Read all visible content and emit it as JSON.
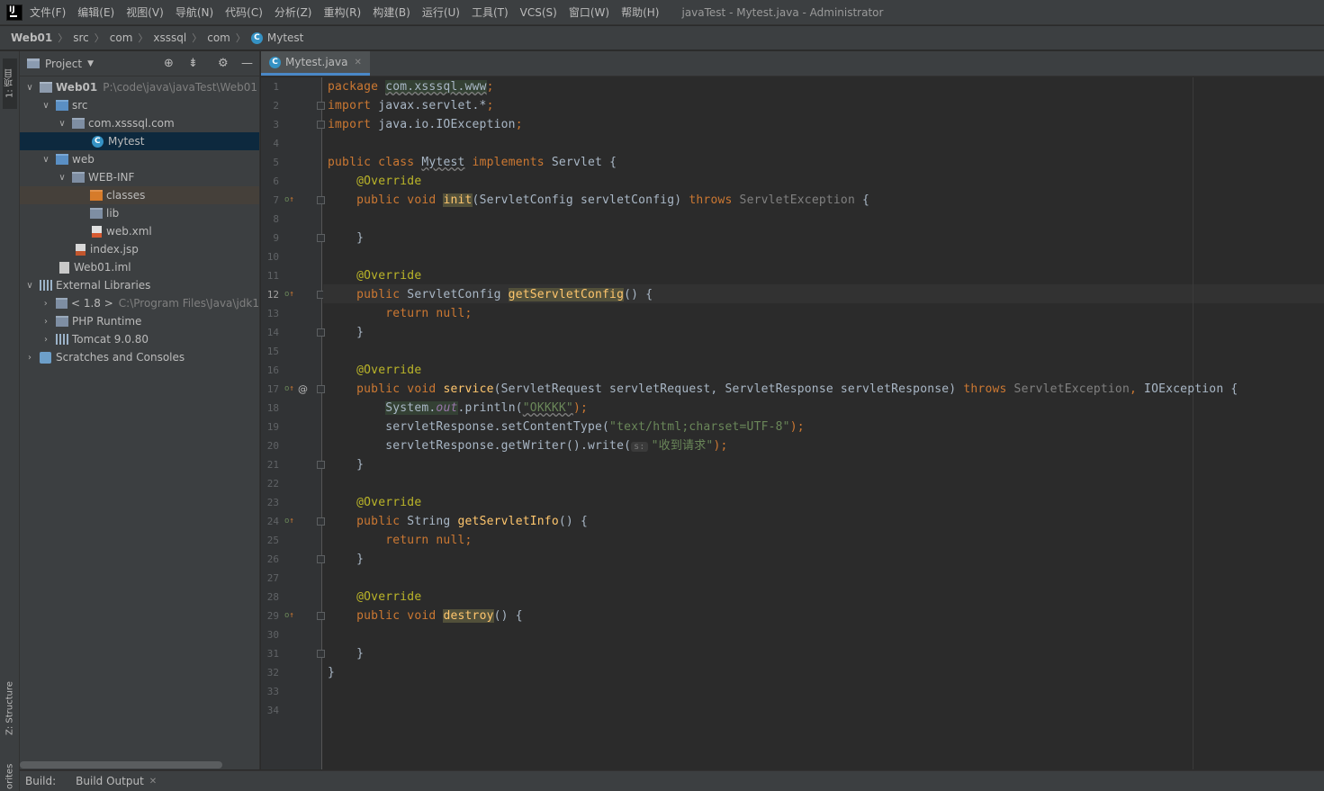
{
  "menubar": {
    "items": [
      "文件(F)",
      "编辑(E)",
      "视图(V)",
      "导航(N)",
      "代码(C)",
      "分析(Z)",
      "重构(R)",
      "构建(B)",
      "运行(U)",
      "工具(T)",
      "VCS(S)",
      "窗口(W)",
      "帮助(H)"
    ],
    "window_title": "javaTest - Mytest.java - Administrator"
  },
  "breadcrumb": [
    "Web01",
    "src",
    "com",
    "xsssql",
    "com",
    "Mytest"
  ],
  "left_strip": {
    "project_tab": "1: 项目",
    "structure_tab": "Z: Structure",
    "favorites_tab": "orites"
  },
  "project_panel": {
    "title": "Project",
    "tree": [
      {
        "label": "Web01",
        "extra": "P:\\code\\java\\javaTest\\Web01"
      },
      {
        "label": "src"
      },
      {
        "label": "com.xsssql.com"
      },
      {
        "label": "Mytest"
      },
      {
        "label": "web"
      },
      {
        "label": "WEB-INF"
      },
      {
        "label": "classes"
      },
      {
        "label": "lib"
      },
      {
        "label": "web.xml"
      },
      {
        "label": "index.jsp"
      },
      {
        "label": "Web01.iml"
      },
      {
        "label": "External Libraries"
      },
      {
        "label": "< 1.8 >",
        "extra": "C:\\Program Files\\Java\\jdk1"
      },
      {
        "label": "PHP Runtime"
      },
      {
        "label": "Tomcat 9.0.80"
      },
      {
        "label": "Scratches and Consoles"
      }
    ]
  },
  "editor": {
    "tab_label": "Mytest.java",
    "line_numbers": [
      "1",
      "2",
      "3",
      "4",
      "5",
      "6",
      "7",
      "8",
      "9",
      "10",
      "11",
      "12",
      "13",
      "14",
      "15",
      "16",
      "17",
      "18",
      "19",
      "20",
      "21",
      "22",
      "23",
      "24",
      "25",
      "26",
      "27",
      "28",
      "29",
      "30",
      "31",
      "32",
      "33",
      "34"
    ],
    "current_line": "12",
    "tokens": {
      "package_kw": "package ",
      "package_name": "com.xsssql.www",
      "semi": ";",
      "import_kw": "import ",
      "import1": "javax.servlet.*",
      "import2": "java.io.IOException",
      "public_class": "public class ",
      "class_name": "Mytest",
      "implements_kw": " implements ",
      "servlet_brace": "Servlet {",
      "override": "@Override",
      "public_void": "public void ",
      "public_kw": "public ",
      "init": "init",
      "init_params": "(ServletConfig servletConfig) ",
      "throws_kw": "throws ",
      "servlet_exception": "ServletException",
      "brace_open": " {",
      "brace_close": "}",
      "servletconfig_type": "ServletConfig ",
      "get_servlet_config": "getServletConfig",
      "paren_brace": "() {",
      "return_null": "return null;",
      "service": "service",
      "service_params": "(ServletRequest servletRequest, ServletResponse servletResponse) ",
      "comma": ", ",
      "ioexception_brace": "IOException {",
      "system": "System",
      "dot": ".",
      "out": "out",
      "println_open": ".println(",
      "okkkk": "\"OKKKK\"",
      "paren_semi": ");",
      "set_content_type": "servletResponse.setContentType(",
      "content_type_str": "\"text/html;charset=UTF-8\"",
      "get_writer": "servletResponse.getWriter().write(",
      "param_hint": "s:",
      "response_str": "\"收到请求\"",
      "string_type": "String ",
      "get_servlet_info": "getServletInfo",
      "destroy": "destroy"
    }
  },
  "bottom_bar": {
    "build_label": "Build:",
    "build_output_tab": "Build Output"
  }
}
